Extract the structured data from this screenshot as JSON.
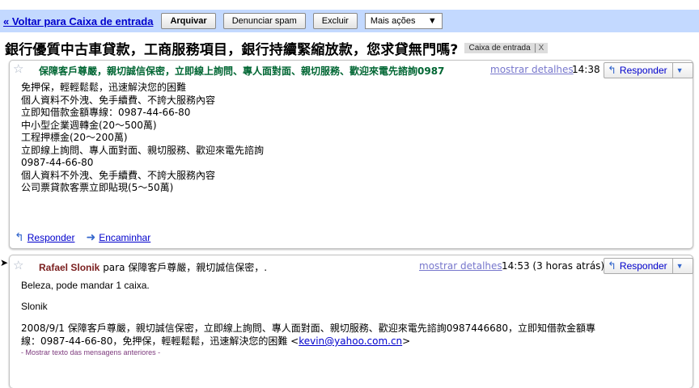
{
  "toolbar": {
    "back_link": "« Voltar para Caixa de entrada",
    "archive": "Arquivar",
    "report_spam": "Denunciar spam",
    "delete": "Excluir",
    "more_actions": "Mais ações",
    "more_actions_arrow": "▼"
  },
  "subject": {
    "title": "銀行優質中古車貸款，工商服務項目，銀行持續緊縮放款，您求貸無門嗎?",
    "label": "Caixa de entrada",
    "label_remove": "X"
  },
  "message1": {
    "sender": "保障客戶尊嚴，親切誠信保密，立即線上詢問、專人面對面、親切服務、歡迎來電先諮詢0987",
    "show_details": "mostrar detalhes",
    "time": "14:38",
    "reply": "Responder",
    "body_lines": [
      "免押保，輕輕鬆鬆，迅速解決您的困難",
      "個人資料不外洩、免手續費、不誇大服務內容",
      "立即知借款金額專線：0987-44-66-80",
      "中小型企業週轉金(20～500萬)",
      "工程押標金(20～200萬)",
      "立即線上詢問、專人面對面、親切服務、歡迎來電先諮詢",
      "0987-44-66-80",
      "個人資料不外洩、免手續費、不誇大服務內容",
      "公司票貸款客票立即貼現(5～50萬)"
    ],
    "footer_reply": "Responder",
    "footer_forward": "Encaminhar"
  },
  "message2": {
    "pointer": "➤",
    "sender": "Rafael Slonik",
    "to_text": "para 保障客戶尊嚴，親切誠信保密，.",
    "show_details": "mostrar detalhes",
    "time": "14:53 (3 horas atrás)",
    "reply": "Responder",
    "line1": "Beleza, pode mandar 1 caixa.",
    "signature": "Slonik",
    "quote_line1": "2008/9/1 保障客戶尊嚴，親切誠信保密，立即線上詢問、專人面對面、親切服務、歡迎來電先諮詢0987446680，立即知借款金額專",
    "quote_line2_pre": "線：0987-44-66-80，免押保，輕輕鬆鬆，迅速解決您的困難 <",
    "quote_email": "kevin@yahoo.com.cn",
    "quote_line2_post": ">",
    "show_quoted": "- Mostrar texto das mensagens anteriores -"
  },
  "colors": {
    "toolbar_bg": "#c3d9ff",
    "sender1": "#006633",
    "sender2": "#7a1e1e",
    "link": "#0000cc"
  },
  "icons": {
    "star": "star-icon",
    "reply": "reply-arrow-icon",
    "forward": "forward-arrow-icon",
    "dropdown": "chevron-down-icon"
  }
}
